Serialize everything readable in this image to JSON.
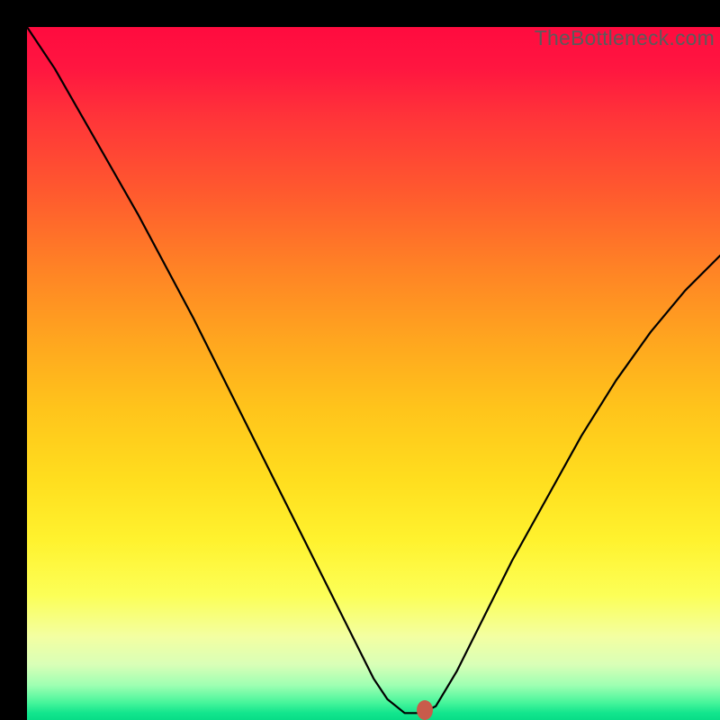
{
  "watermark": "TheBottleneck.com",
  "marker": {
    "x_pct": 57.4,
    "y_pct": 98.6
  },
  "chart_data": {
    "type": "line",
    "title": "",
    "xlabel": "",
    "ylabel": "",
    "xlim": [
      0,
      100
    ],
    "ylim": [
      0,
      100
    ],
    "grid": false,
    "legend": false,
    "series": [
      {
        "name": "bottleneck-curve",
        "x": [
          0,
          4,
          8,
          12,
          16,
          20,
          24,
          28,
          32,
          36,
          40,
          44,
          48,
          50,
          52,
          54.5,
          57.0,
          59,
          62,
          66,
          70,
          75,
          80,
          85,
          90,
          95,
          100
        ],
        "y": [
          100,
          94,
          87,
          80,
          73,
          65.5,
          58,
          50,
          42,
          34,
          26,
          18,
          10,
          6,
          3,
          1.0,
          1.0,
          2,
          7,
          15,
          23,
          32,
          41,
          49,
          56,
          62,
          67
        ]
      }
    ],
    "annotations": [
      {
        "kind": "marker",
        "x": 57.4,
        "y": 1.4
      }
    ]
  }
}
